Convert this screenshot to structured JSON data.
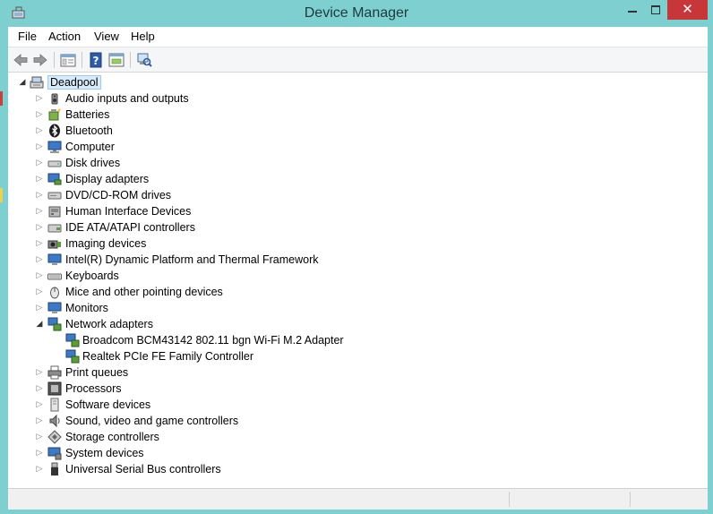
{
  "window": {
    "title": "Device Manager",
    "close_glyph": "✕"
  },
  "menu": {
    "file": "File",
    "action": "Action",
    "view": "View",
    "help": "Help"
  },
  "toolbar": {
    "icons": [
      "back-arrow-icon",
      "forward-arrow-icon",
      "properties-icon",
      "help-icon",
      "show-hidden-icon",
      "scan-hardware-icon"
    ]
  },
  "tree": {
    "root": "Deadpool",
    "categories": [
      {
        "label": "Audio inputs and outputs",
        "icon": "speaker-icon",
        "expanded": false
      },
      {
        "label": "Batteries",
        "icon": "battery-icon",
        "expanded": false
      },
      {
        "label": "Bluetooth",
        "icon": "bluetooth-icon",
        "expanded": false
      },
      {
        "label": "Computer",
        "icon": "computer-icon",
        "expanded": false
      },
      {
        "label": "Disk drives",
        "icon": "disk-drive-icon",
        "expanded": false
      },
      {
        "label": "Display adapters",
        "icon": "display-adapter-icon",
        "expanded": false
      },
      {
        "label": "DVD/CD-ROM drives",
        "icon": "dvd-drive-icon",
        "expanded": false
      },
      {
        "label": "Human Interface Devices",
        "icon": "hid-icon",
        "expanded": false
      },
      {
        "label": "IDE ATA/ATAPI controllers",
        "icon": "ide-controller-icon",
        "expanded": false
      },
      {
        "label": "Imaging devices",
        "icon": "camera-icon",
        "expanded": false
      },
      {
        "label": "Intel(R) Dynamic Platform and Thermal Framework",
        "icon": "monitor-chip-icon",
        "expanded": false
      },
      {
        "label": "Keyboards",
        "icon": "keyboard-icon",
        "expanded": false
      },
      {
        "label": "Mice and other pointing devices",
        "icon": "mouse-icon",
        "expanded": false
      },
      {
        "label": "Monitors",
        "icon": "monitor-icon",
        "expanded": false
      },
      {
        "label": "Network adapters",
        "icon": "network-adapter-icon",
        "expanded": true,
        "children": [
          {
            "label": "Broadcom BCM43142 802.11 bgn Wi-Fi M.2 Adapter",
            "icon": "network-adapter-icon"
          },
          {
            "label": "Realtek PCIe FE Family Controller",
            "icon": "network-adapter-icon"
          }
        ]
      },
      {
        "label": "Print queues",
        "icon": "printer-icon",
        "expanded": false
      },
      {
        "label": "Processors",
        "icon": "processor-icon",
        "expanded": false
      },
      {
        "label": "Software devices",
        "icon": "software-device-icon",
        "expanded": false
      },
      {
        "label": "Sound, video and game controllers",
        "icon": "speaker-icon",
        "expanded": false
      },
      {
        "label": "Storage controllers",
        "icon": "storage-controller-icon",
        "expanded": false
      },
      {
        "label": "System devices",
        "icon": "system-device-icon",
        "expanded": false
      },
      {
        "label": "Universal Serial Bus controllers",
        "icon": "usb-icon",
        "expanded": false
      }
    ]
  },
  "colors": {
    "window_frame": "#7ecfd0",
    "close_button": "#c7373a",
    "selection_fill": "#d9ebf9",
    "selection_border": "#99cdef"
  }
}
